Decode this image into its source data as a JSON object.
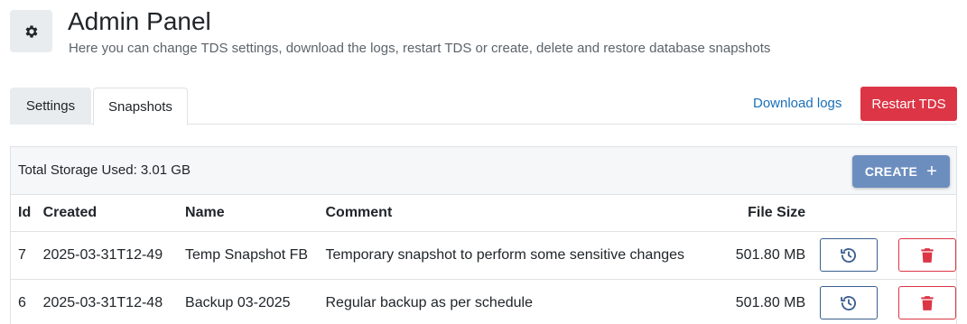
{
  "header": {
    "icon": "gear-icon",
    "title": "Admin Panel",
    "subtitle": "Here you can change TDS settings, download the logs, restart TDS or create, delete and restore database snapshots"
  },
  "tabs": [
    {
      "label": "Settings",
      "active": false
    },
    {
      "label": "Snapshots",
      "active": true
    }
  ],
  "actions": {
    "download_logs": "Download logs",
    "restart": "Restart TDS"
  },
  "snapshots": {
    "storage_used": "Total Storage Used: 3.01 GB",
    "create_label": "CREATE",
    "columns": {
      "id": "Id",
      "created": "Created",
      "name": "Name",
      "comment": "Comment",
      "file_size": "File Size"
    },
    "rows": [
      {
        "id": "7",
        "created": "2025-03-31T12-49",
        "name": "Temp Snapshot FB",
        "comment": "Temporary snapshot to perform some sensitive changes",
        "file_size": "501.80 MB"
      },
      {
        "id": "6",
        "created": "2025-03-31T12-48",
        "name": "Backup 03-2025",
        "comment": "Regular backup as per schedule",
        "file_size": "501.80 MB"
      }
    ]
  },
  "colors": {
    "danger": "#dc3545",
    "link": "#1a6fb8",
    "create_button": "#6c8ebf",
    "restore_outline": "#3b5f8f"
  }
}
